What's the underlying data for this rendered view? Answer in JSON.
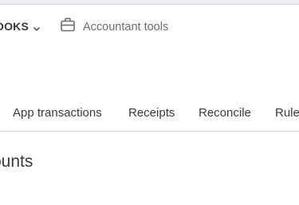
{
  "header": {
    "books_menu_label": "OOKS",
    "accountant_tools_label": "Accountant tools"
  },
  "tabs": [
    {
      "label": "App transactions"
    },
    {
      "label": "Receipts"
    },
    {
      "label": "Reconcile"
    },
    {
      "label": "Rule"
    }
  ],
  "section": {
    "title": "ounts"
  },
  "icons": {
    "books_chevron": "chevron-down-icon",
    "accountant_tools": "briefcase-icon"
  }
}
